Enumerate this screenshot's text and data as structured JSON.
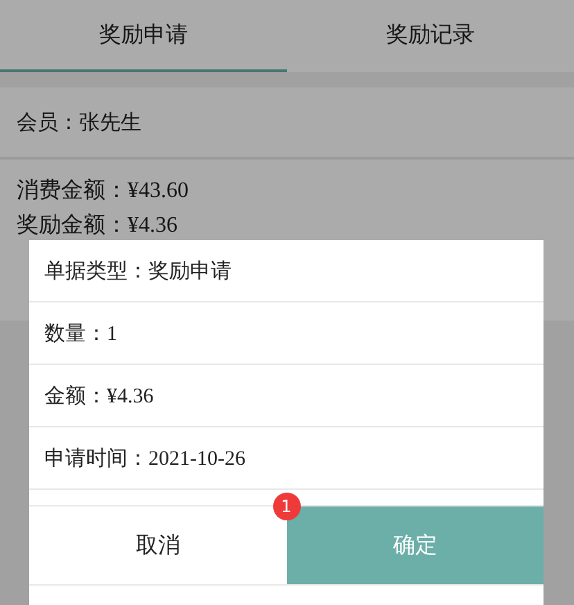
{
  "tabs": [
    {
      "label": "奖励申请",
      "selected": true
    },
    {
      "label": "奖励记录",
      "selected": false
    }
  ],
  "member": "会员：张先生",
  "details": [
    "消费金额：¥43.60",
    "奖励金额：¥4.36"
  ],
  "dialog": {
    "rows": [
      "单据类型：奖励申请",
      "数量：1",
      "金额：¥4.36",
      "申请时间：2021-10-26"
    ],
    "buttons": [
      {
        "label": "取消",
        "kind": "secondary"
      },
      {
        "label": "确定",
        "kind": "primary",
        "badge": "1"
      }
    ]
  }
}
